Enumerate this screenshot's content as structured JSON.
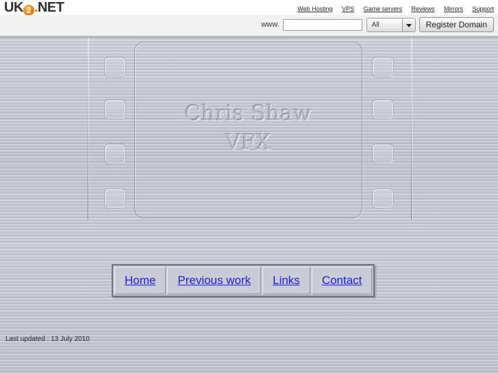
{
  "host_banner": {
    "logo": {
      "prefix": "UK",
      "badge": "2",
      "dot": ".",
      "suffix": "NET"
    },
    "nav_links": [
      {
        "label": "Web Hosting"
      },
      {
        "label": "VPS"
      },
      {
        "label": "Game servers"
      },
      {
        "label": "Reviews"
      },
      {
        "label": "Mirrors"
      },
      {
        "label": "Support"
      }
    ],
    "search": {
      "prefix_label": "www.",
      "domain_value": "",
      "domain_placeholder": "",
      "tld_selected": "All",
      "tld_options": [
        "All"
      ],
      "register_button": "Register Domain"
    }
  },
  "page": {
    "title_line1": "Chris Shaw",
    "title_line2": "VFX",
    "menu": [
      {
        "label": "Home"
      },
      {
        "label": "Previous work"
      },
      {
        "label": "Links"
      },
      {
        "label": "Contact"
      }
    ],
    "last_updated": "Last updated : 13 July 2010"
  },
  "colors": {
    "metal_base": "#c3c5cf",
    "link_blue": "#1a1ae6",
    "logo_orange": "#f07c10",
    "banner_bg": "#ffffff",
    "search_bar_bg": "#f1f1f1",
    "emboss_text": "#b9bbc6"
  }
}
